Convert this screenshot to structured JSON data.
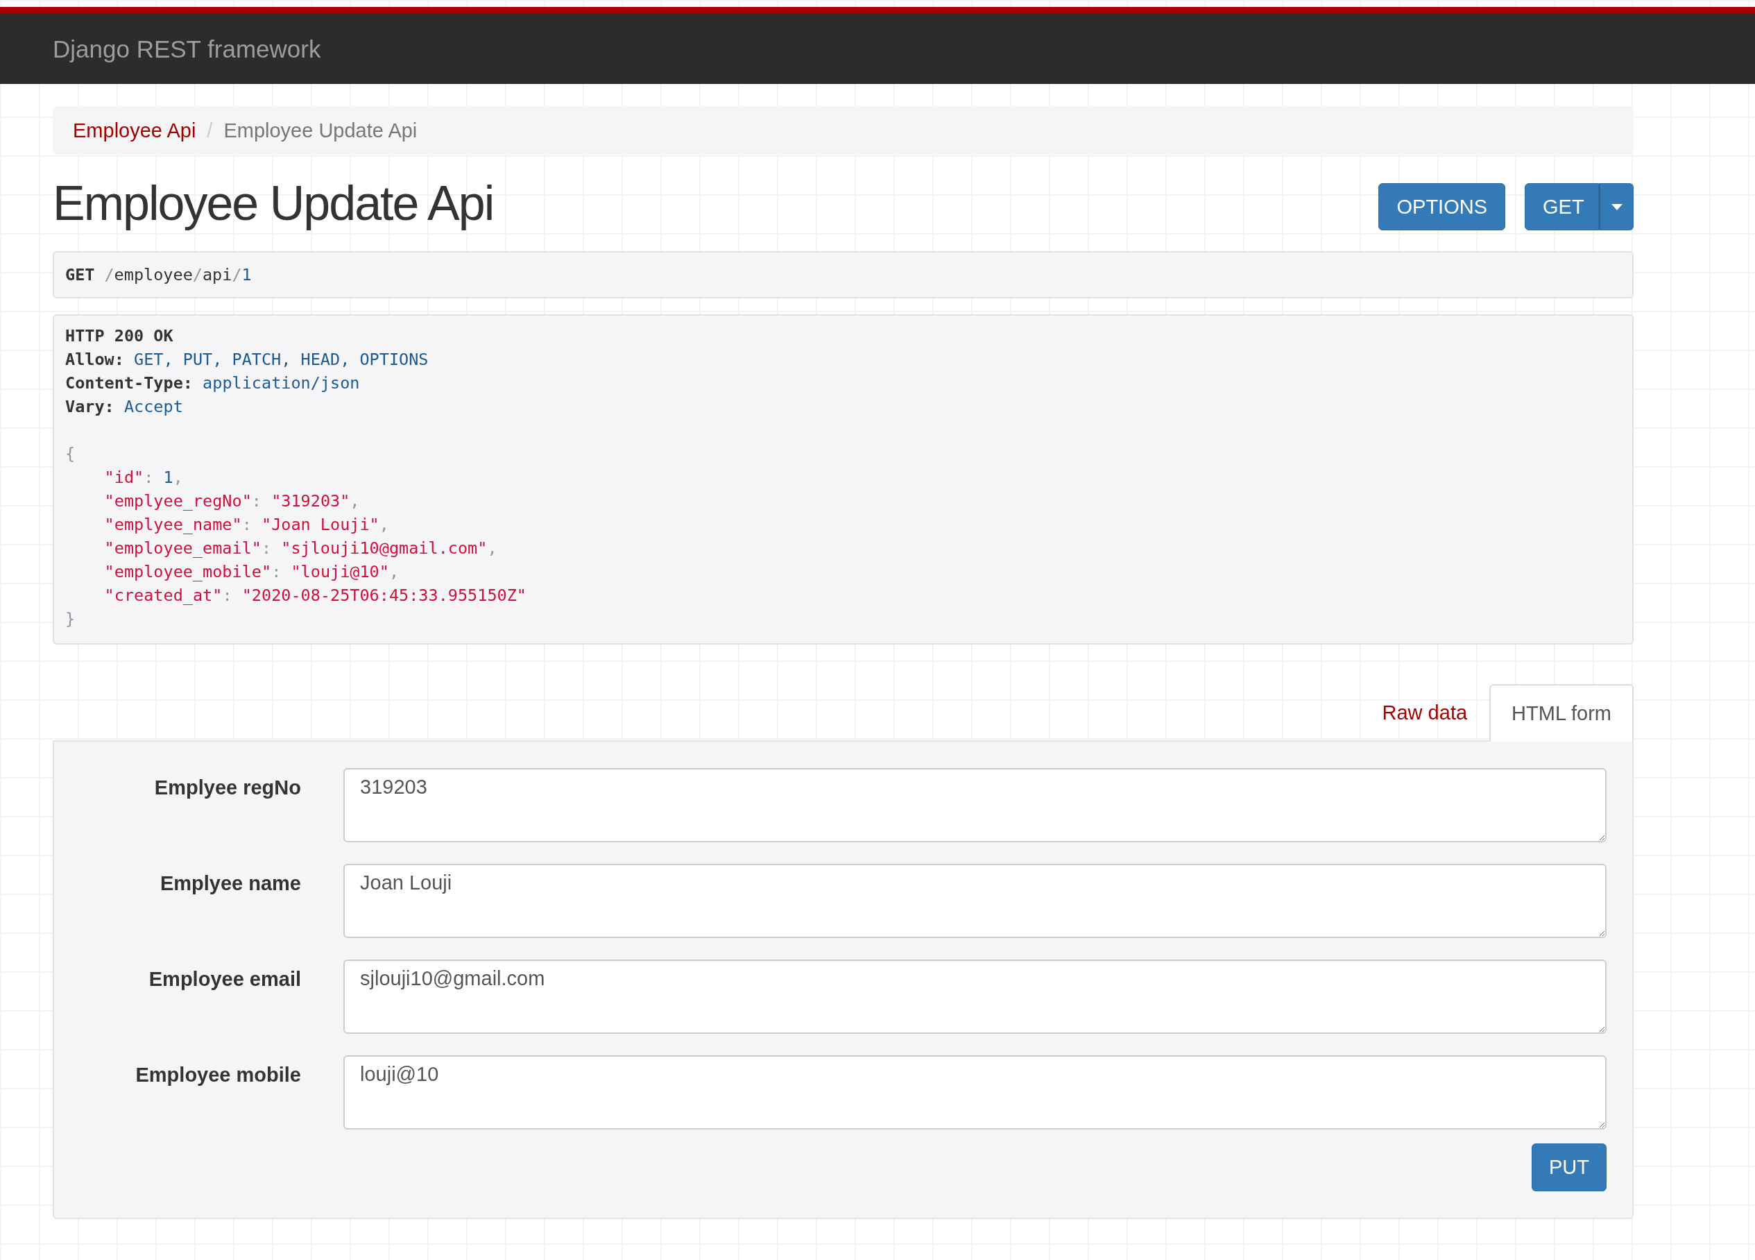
{
  "navbar": {
    "brand": "Django REST framework"
  },
  "breadcrumb": [
    {
      "label": "Employee Api",
      "selected": false
    },
    {
      "label": "Employee Update Api",
      "selected": true
    }
  ],
  "breadcrumb_separator": "/",
  "page_title": "Employee Update Api",
  "actions": {
    "options": "OPTIONS",
    "get": "GET"
  },
  "request": {
    "method": "GET",
    "path": "/employee/api/1"
  },
  "response": {
    "status": "HTTP 200 OK",
    "headers": [
      {
        "name": "Allow:",
        "value": "GET, PUT, PATCH, HEAD, OPTIONS"
      },
      {
        "name": "Content-Type:",
        "value": "application/json"
      },
      {
        "name": "Vary:",
        "value": "Accept"
      }
    ],
    "body": {
      "open": "{",
      "close": "}",
      "colon": ":",
      "comma": ",",
      "entries": [
        {
          "key": "\"id\"",
          "value": "1",
          "kind": "number"
        },
        {
          "key": "\"emplyee_regNo\"",
          "value": "\"319203\"",
          "kind": "string"
        },
        {
          "key": "\"emplyee_name\"",
          "value": "\"Joan Louji\"",
          "kind": "string"
        },
        {
          "key": "\"employee_email\"",
          "value": "\"sjlouji10@gmail.com\"",
          "kind": "string"
        },
        {
          "key": "\"employee_mobile\"",
          "value": "\"louji@10\"",
          "kind": "string"
        },
        {
          "key": "\"created_at\"",
          "value": "\"2020-08-25T06:45:33.955150Z\"",
          "kind": "string"
        }
      ]
    }
  },
  "tabs": [
    {
      "label": "Raw data",
      "selected": false
    },
    {
      "label": "HTML form",
      "selected": true
    }
  ],
  "form": {
    "fields": [
      {
        "label": "Emplyee regNo",
        "value": "319203"
      },
      {
        "label": "Emplyee name",
        "value": "Joan Louji"
      },
      {
        "label": "Employee email",
        "value": "sjlouji10@gmail.com"
      },
      {
        "label": "Employee mobile",
        "value": "louji@10"
      }
    ],
    "submit": "PUT"
  }
}
